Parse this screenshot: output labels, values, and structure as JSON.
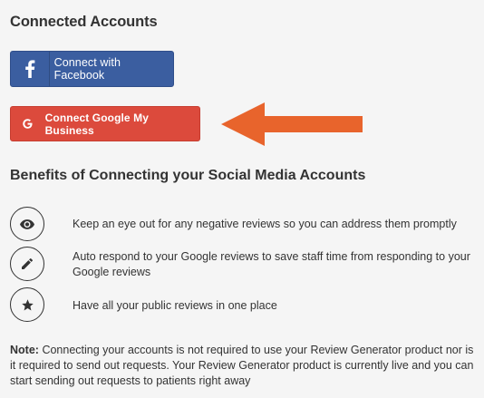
{
  "connected_accounts": {
    "title": "Connected Accounts",
    "facebook_button": {
      "label": "Connect with Facebook",
      "icon": "facebook-icon",
      "color": "#3b5ea0"
    },
    "google_button": {
      "label": "Connect Google My Business",
      "icon": "google-icon",
      "color": "#dc4a3c"
    },
    "arrow_color": "#e8642c"
  },
  "benefits": {
    "title": "Benefits of Connecting your Social Media Accounts",
    "items": [
      {
        "icon": "eye-icon",
        "text": "Keep an eye out for any negative reviews so you can address them promptly"
      },
      {
        "icon": "pencil-icon",
        "text": "Auto respond to your Google reviews to save staff time from responding to your Google reviews"
      },
      {
        "icon": "star-icon",
        "text": "Have all your public reviews in one place"
      }
    ]
  },
  "note": {
    "label": "Note:",
    "text": "Connecting your accounts is not required to use your Review Generator product nor is it required to send out requests. Your Review Generator product is currently live and you can start sending out requests to patients right away"
  }
}
